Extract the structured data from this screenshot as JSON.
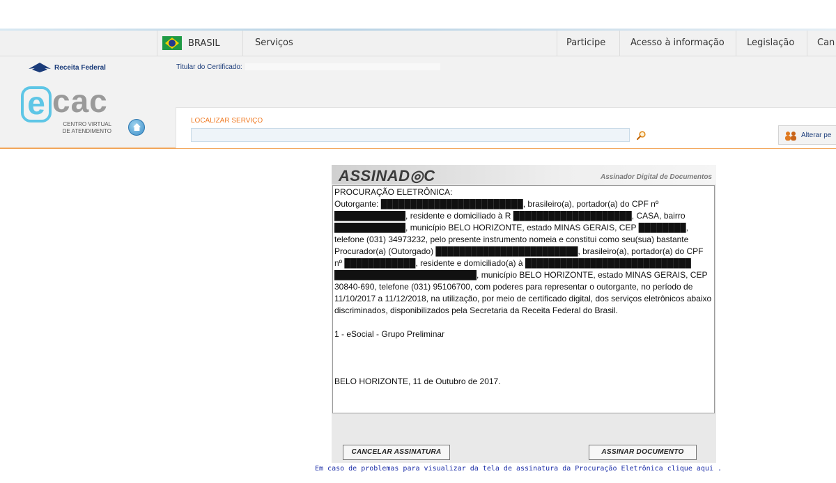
{
  "govbar": {
    "brasil": "BRASIL",
    "servicos": "Serviços",
    "participe": "Participe",
    "acesso": "Acesso à informação",
    "legislacao": "Legislação",
    "canais": "Can"
  },
  "header": {
    "rf_logo": "Receita Federal",
    "titular_label": "Titular do Certificado:",
    "ecac_e": "e",
    "ecac_cac": "cac",
    "ecac_sub1": "CENTRO VIRTUAL",
    "ecac_sub2": "DE ATENDIMENTO",
    "search_label": "LOCALIZAR SERVIÇO",
    "search_value": "",
    "alterar": "Alterar pe"
  },
  "assinador": {
    "logo": "ASSINAD◎C",
    "subtitle": "Assinador Digital de Documentos",
    "doc_title": "PROCURAÇÃO ELETRÔNICA:",
    "doc_body": "Outorgante: ████████████████████████, brasileiro(a), portador(a) do CPF nº ████████████, residente e domiciliado à R ████████████████████, CASA, bairro ████████████, município BELO HORIZONTE, estado MINAS GERAIS, CEP ████████, telefone (031) 34973232, pelo presente instrumento nomeia e constitui como seu(sua) bastante Procurador(a) (Outorgado) ████████████████████████, brasileiro(a), portador(a) do CPF nº ████████████, residente e domiciliado(a) à ████████████████████████████ ████████████████████████, município BELO HORIZONTE, estado MINAS GERAIS, CEP 30840-690,  telefone (031) 95106700, com poderes para representar o outorgante, no período de 11/10/2017 a 11/12/2018, na utilização, por meio de certificado digital, dos serviços eletrônicos abaixo discriminados, disponibilizados pela Secretaria da Receita Federal do Brasil.",
    "doc_item": "1 - eSocial - Grupo Preliminar",
    "doc_footer": "BELO HORIZONTE, 11 de Outubro de 2017.",
    "cancel": "CANCELAR ASSINATURA",
    "sign": "ASSINAR DOCUMENTO"
  },
  "help": {
    "text": "Em caso de problemas para visualizar da tela de assinatura da Procuração Eletrônica clique",
    "link": "aqui",
    "end": "."
  }
}
